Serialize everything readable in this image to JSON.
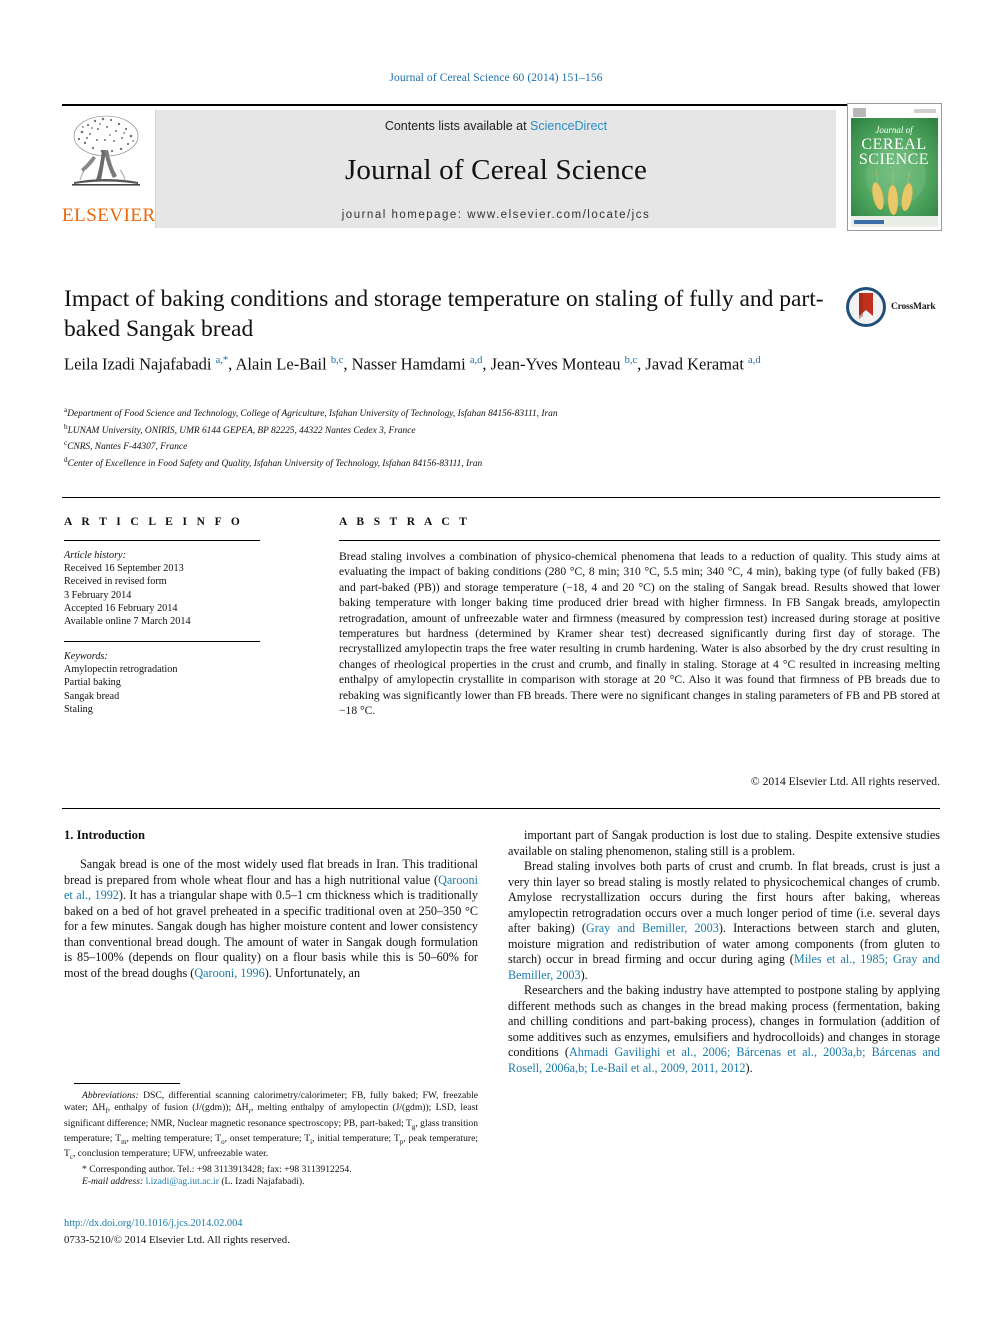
{
  "running_head": "Journal of Cereal Science 60 (2014) 151–156",
  "publisher": {
    "logo_word": "ELSEVIER",
    "logo_icon": "elsevier-tree-logo"
  },
  "journal_band": {
    "contents_prefix": "Contents lists available at ",
    "contents_link": "ScienceDirect",
    "journal_title": "Journal of Cereal Science",
    "homepage": "journal homepage: www.elsevier.com/locate/jcs"
  },
  "cover": {
    "line1": "Journal of",
    "line2": "CEREAL",
    "line3": "SCIENCE"
  },
  "crossmark": {
    "label": "CrossMark"
  },
  "article": {
    "title": "Impact of baking conditions and storage temperature on staling of fully and part-baked Sangak bread",
    "authors_html": "Leila Izadi Najafabadi <sup>a,*</sup>, Alain Le-Bail <sup>b,c</sup>, Nasser Hamdami <sup>a,d</sup>, Jean-Yves Monteau <sup>b,c</sup>, Javad Keramat <sup>a,d</sup>",
    "affiliations": [
      {
        "marker": "a",
        "text": "Department of Food Science and Technology, College of Agriculture, Isfahan University of Technology, Isfahan 84156-83111, Iran"
      },
      {
        "marker": "b",
        "text": "LUNAM University, ONIRIS, UMR 6144 GEPEA, BP 82225, 44322 Nantes Cedex 3, France"
      },
      {
        "marker": "c",
        "text": "CNRS, Nantes F-44307, France"
      },
      {
        "marker": "d",
        "text": "Center of Excellence in Food Safety and Quality, Isfahan University of Technology, Isfahan 84156-83111, Iran"
      }
    ]
  },
  "article_info": {
    "heading": "A R T I C L E   I N F O",
    "history_label": "Article history:",
    "history": [
      "Received 16 September 2013",
      "Received in revised form",
      "3 February 2014",
      "Accepted 16 February 2014",
      "Available online 7 March 2014"
    ],
    "keywords_label": "Keywords:",
    "keywords": [
      "Amylopectin retrogradation",
      "Partial baking",
      "Sangak bread",
      "Staling"
    ]
  },
  "abstract": {
    "heading": "A B S T R A C T",
    "text": "Bread staling involves a combination of physico-chemical phenomena that leads to a reduction of quality. This study aims at evaluating the impact of baking conditions (280 °C, 8 min; 310 °C, 5.5 min; 340 °C, 4 min), baking type (of fully baked (FB) and part-baked (PB)) and storage temperature (−18, 4 and 20 °C) on the staling of Sangak bread. Results showed that lower baking temperature with longer baking time produced drier bread with higher firmness. In FB Sangak breads, amylopectin retrogradation, amount of unfreezable water and firmness (measured by compression test) increased during storage at positive temperatures but hardness (determined by Kramer shear test) decreased significantly during first day of storage. The recrystallized amylopectin traps the free water resulting in crumb hardening. Water is also absorbed by the dry crust resulting in changes of rheological properties in the crust and crumb, and finally in staling. Storage at 4 °C resulted in increasing melting enthalpy of amylopectin crystallite in comparison with storage at 20 °C. Also it was found that firmness of PB breads due to rebaking was significantly lower than FB breads. There were no significant changes in staling parameters of FB and PB stored at −18 °C.",
    "copyright": "© 2014 Elsevier Ltd. All rights reserved."
  },
  "body": {
    "section_number_title": "1.  Introduction",
    "left_paragraphs": [
      "Sangak bread is one of the most widely used flat breads in Iran. This traditional bread is prepared from whole wheat flour and has a high nutritional value (§REF§Qarooni et al., 1992§/REF§). It has a triangular shape with 0.5–1 cm thickness which is traditionally baked on a bed of hot gravel preheated in a specific traditional oven at 250–350 °C for a few minutes. Sangak dough has higher moisture content and lower consistency than conventional bread dough. The amount of water in Sangak dough formulation is 85–100% (depends on flour quality) on a flour basis while this is 50–60% for most of the bread doughs (§REF§Qarooni, 1996§/REF§). Unfortunately, an"
    ],
    "right_paragraphs": [
      "important part of Sangak production is lost due to staling. Despite extensive studies available on staling phenomenon, staling still is a problem.",
      "Bread staling involves both parts of crust and crumb. In flat breads, crust is just a very thin layer so bread staling is mostly related to physicochemical changes of crumb. Amylose recrystallization occurs during the first hours after baking, whereas amylopectin retrogradation occurs over a much longer period of time (i.e. several days after baking) (§REF§Gray and Bemiller, 2003§/REF§). Interactions between starch and gluten, moisture migration and redistribution of water among components (from gluten to starch) occur in bread firming and occur during aging (§REF§Miles et al., 1985; Gray and Bemiller, 2003§/REF§).",
      "Researchers and the baking industry have attempted to postpone staling by applying different methods such as changes in the bread making process (fermentation, baking and chilling conditions and part-baking process), changes in formulation (addition of some additives such as enzymes, emulsifiers and hydrocolloids) and changes in storage conditions (§REF§Ahmadi Gavilighi et al., 2006; Bárcenas et al., 2003a,b; Bárcenas and Rosell, 2006a,b; Le-Bail et al., 2009, 2011, 2012§/REF§)."
    ]
  },
  "footnote": {
    "abbreviations_label": "Abbreviations:",
    "abbreviations_text": "DSC, differential scanning calorimetry/calorimeter; FB, fully baked; FW, freezable water; ΔH<sub>f</sub>, enthalpy of fusion (J/(gdm)); ΔH<sub>r</sub>, melting enthalpy of amylopectin (J/(gdm)); LSD, least significant difference; NMR, Nuclear magnetic resonance spectroscopy; PB, part-baked; T<sub>g</sub>, glass transition temperature; T<sub>m</sub>, melting temperature; T<sub>o</sub>, onset temperature; T<sub>i</sub>, initial temperature; T<sub>p</sub>, peak temperature; T<sub>c</sub>, conclusion temperature; UFW, unfreezable water.",
    "corresponding": "* Corresponding author. Tel.: +98 3113913428; fax: +98 3113912254.",
    "email_label": "E-mail address:",
    "email": "l.izadi@ag.iut.ac.ir",
    "email_owner": "(L. Izadi Najafabadi)."
  },
  "footer": {
    "doi": "http://dx.doi.org/10.1016/j.jcs.2014.02.004",
    "issn_line": "0733-5210/© 2014 Elsevier Ltd. All rights reserved."
  },
  "colors": {
    "link_blue": "#1a7ba8",
    "header_blue": "#1a6ea8",
    "sciencedirect_blue": "#2a8ec6",
    "elsevier_orange": "#ec6707",
    "band_gray": "#e6e6e6",
    "cover_green": "#3f9b4e"
  }
}
